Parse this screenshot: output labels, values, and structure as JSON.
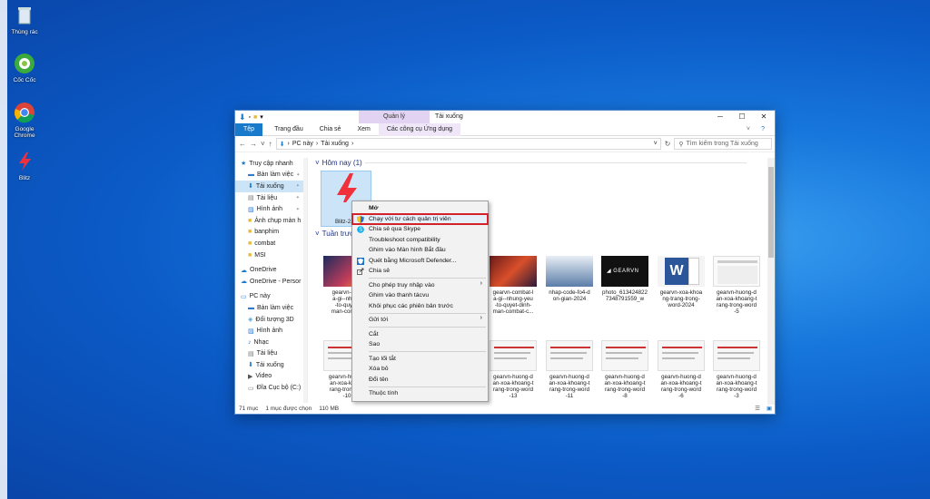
{
  "desktop": {
    "icons": [
      {
        "label": "Thùng rác",
        "icon": "recycle-bin-icon"
      },
      {
        "label": "Cốc Cốc",
        "icon": "coccoc-icon"
      },
      {
        "label": "Google Chrome",
        "icon": "chrome-icon"
      },
      {
        "label": "Blitz",
        "icon": "blitz-icon"
      }
    ]
  },
  "window": {
    "title": "Tải xuống",
    "context_tab": "Quản lý",
    "ribbon": {
      "file": "Tệp",
      "home": "Trang đầu",
      "share": "Chia sẻ",
      "view": "Xem",
      "app_tools": "Các công cụ Ứng dụng"
    },
    "address": {
      "root": "PC này",
      "folder": "Tải xuống"
    },
    "search_placeholder": "Tìm kiếm trong Tải xuống",
    "sidebar": [
      {
        "label": "Truy cập nhanh",
        "icon": "star-icon"
      },
      {
        "label": "Bàn làm việc",
        "icon": "desktop-icon"
      },
      {
        "label": "Tải xuống",
        "icon": "download-icon"
      },
      {
        "label": "Tài liệu",
        "icon": "documents-icon"
      },
      {
        "label": "Hình ảnh",
        "icon": "pictures-icon"
      },
      {
        "label": "Ảnh chụp màn h",
        "icon": "folder-icon"
      },
      {
        "label": "banphim",
        "icon": "folder-icon"
      },
      {
        "label": "combat",
        "icon": "folder-icon"
      },
      {
        "label": "MSI",
        "icon": "folder-icon"
      },
      {
        "label": "OneDrive",
        "icon": "cloud-icon"
      },
      {
        "label": "OneDrive - Persor",
        "icon": "cloud-icon"
      },
      {
        "label": "PC này",
        "icon": "pc-icon"
      },
      {
        "label": "Bàn làm việc",
        "icon": "desktop-icon"
      },
      {
        "label": "Đối tượng 3D",
        "icon": "cube-icon"
      },
      {
        "label": "Hình ảnh",
        "icon": "pictures-icon"
      },
      {
        "label": "Nhạc",
        "icon": "music-icon"
      },
      {
        "label": "Tài liệu",
        "icon": "documents-icon"
      },
      {
        "label": "Tải xuống",
        "icon": "download-icon"
      },
      {
        "label": "Video",
        "icon": "video-icon"
      },
      {
        "label": "Đĩa Cục bộ (C:)",
        "icon": "drive-icon"
      }
    ],
    "groups": {
      "today": "Hôm nay (1)",
      "last_week": "Tuần trước"
    },
    "selected_file": "Blitz-2.1.",
    "files_row1": [
      {
        "name": "gearvn-com\na-gi--nhung\n-to-quyet-\nman-combat"
      },
      {
        "name": "gearvn-combat-l\na-gi--nhung-yeu\n-to-quyet-dinh-\nman-combat-c..."
      },
      {
        "name": "nhap-code-fo4-d\non-gian-2024"
      },
      {
        "name": "photo_613424822\n7348791559_w"
      },
      {
        "name": "gearvn-xoa-khoa\nng-trang-trong-\nword-2024"
      },
      {
        "name": "gearvn-huong-d\nan-xoa-khoang-t\nrang-trong-word\n-5"
      }
    ],
    "files_row2": [
      {
        "name": "gearvn-huong-\nan-xoa-khoan\nrang-trong-wo\n-10"
      },
      {
        "name": "gearvn-huong-d\nan-xoa-khoang-t\nrang-trong-word\n-13"
      },
      {
        "name": "gearvn-huong-d\nan-xoa-khoang-t\nrang-trong-word\n-11"
      },
      {
        "name": "gearvn-huong-d\nan-xoa-khoang-t\nrang-trong-word\n-8"
      },
      {
        "name": "gearvn-huong-d\nan-xoa-khoang-t\nrang-trong-word\n-6"
      },
      {
        "name": "gearvn-huong-d\nan-xoa-khoang-t\nrang-trong-word\n-3"
      }
    ],
    "status": {
      "count": "71 mục",
      "selected": "1 mục được chọn",
      "size": "110 MB"
    }
  },
  "context_menu": {
    "items": [
      {
        "label": "Mở",
        "bold": true
      },
      {
        "label": "Chạy với tư cách quản trị viên",
        "icon": "shield-icon",
        "highlight": true
      },
      {
        "label": "Chia sẻ qua Skype",
        "icon": "skype-icon"
      },
      {
        "label": "Troubleshoot compatibility"
      },
      {
        "label": "Ghim vào Màn hình Bắt đầu"
      },
      {
        "label": "Quét bằng Microsoft Defender...",
        "icon": "defender-icon"
      },
      {
        "label": "Chia sẻ",
        "icon": "share-icon"
      },
      {
        "sep": true
      },
      {
        "label": "Cho phép truy nhập vào",
        "arrow": true
      },
      {
        "label": "Ghim vào thanh tácvu"
      },
      {
        "label": "Khôi phục các phiên bản trước"
      },
      {
        "sep": true
      },
      {
        "label": "Gửi tới",
        "arrow": true
      },
      {
        "sep": true
      },
      {
        "label": "Cắt"
      },
      {
        "label": "Sao"
      },
      {
        "sep": true
      },
      {
        "label": "Tạo lối tắt"
      },
      {
        "label": "Xóa bỏ"
      },
      {
        "label": "Đổi tên"
      },
      {
        "sep": true
      },
      {
        "label": "Thuộc tính"
      }
    ]
  },
  "colors": {
    "accent": "#1979ca",
    "highlight_border": "#d3222a",
    "blitz": "#f0303a"
  }
}
